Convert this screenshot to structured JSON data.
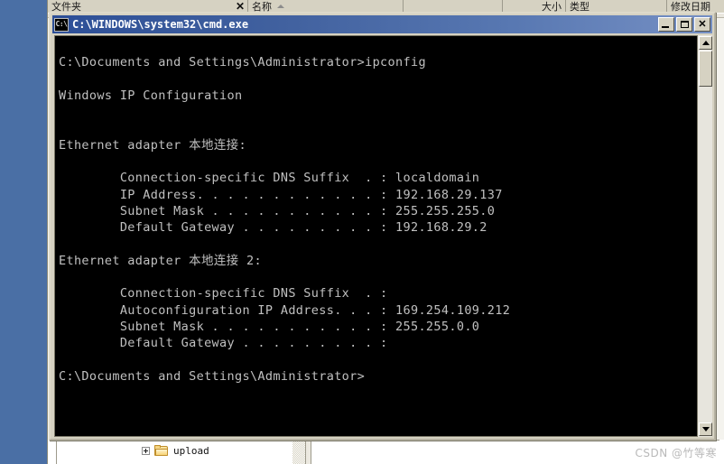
{
  "desktop": {
    "background_color": "#4a6fa5"
  },
  "explorer_window": {
    "columns": [
      {
        "label": "文件夹",
        "name": "folders"
      },
      {
        "label": "名称",
        "name": "name"
      },
      {
        "label": "大小",
        "name": "size"
      },
      {
        "label": "类型",
        "name": "type"
      },
      {
        "label": "修改日期",
        "name": "date-modified"
      }
    ],
    "close_label": "✕",
    "tree": {
      "items": [
        {
          "label": "upload",
          "expander": "+",
          "icon": "folder-icon"
        }
      ]
    }
  },
  "cmd_window": {
    "title": "C:\\WINDOWS\\system32\\cmd.exe",
    "icon_text": "C:\\",
    "titlebar_gradient_start": "#2d4f97",
    "titlebar_gradient_end": "#7690c4",
    "buttons": {
      "minimize": "_",
      "maximize": "□",
      "close": "✕"
    },
    "console": {
      "background_color": "#000000",
      "text_color": "#c0c0c0",
      "lines": [
        "",
        "C:\\Documents and Settings\\Administrator>ipconfig",
        "",
        "Windows IP Configuration",
        "",
        "",
        "Ethernet adapter 本地连接:",
        "",
        "        Connection-specific DNS Suffix  . : localdomain",
        "        IP Address. . . . . . . . . . . . : 192.168.29.137",
        "        Subnet Mask . . . . . . . . . . . : 255.255.255.0",
        "        Default Gateway . . . . . . . . . : 192.168.29.2",
        "",
        "Ethernet adapter 本地连接 2:",
        "",
        "        Connection-specific DNS Suffix  . :",
        "        Autoconfiguration IP Address. . . : 169.254.109.212",
        "        Subnet Mask . . . . . . . . . . . : 255.255.0.0",
        "        Default Gateway . . . . . . . . . :",
        "",
        "C:\\Documents and Settings\\Administrator>"
      ],
      "command": "ipconfig",
      "prompt": "C:\\Documents and Settings\\Administrator>",
      "adapters": [
        {
          "name": "Ethernet adapter 本地连接:",
          "dns_suffix": "localdomain",
          "ip_address": "192.168.29.137",
          "subnet_mask": "255.255.255.0",
          "default_gateway": "192.168.29.2"
        },
        {
          "name": "Ethernet adapter 本地连接 2:",
          "dns_suffix": "",
          "autoconfiguration_ip_address": "169.254.109.212",
          "subnet_mask": "255.255.0.0",
          "default_gateway": ""
        }
      ]
    }
  },
  "watermark": {
    "text": "CSDN @竹等寒"
  }
}
